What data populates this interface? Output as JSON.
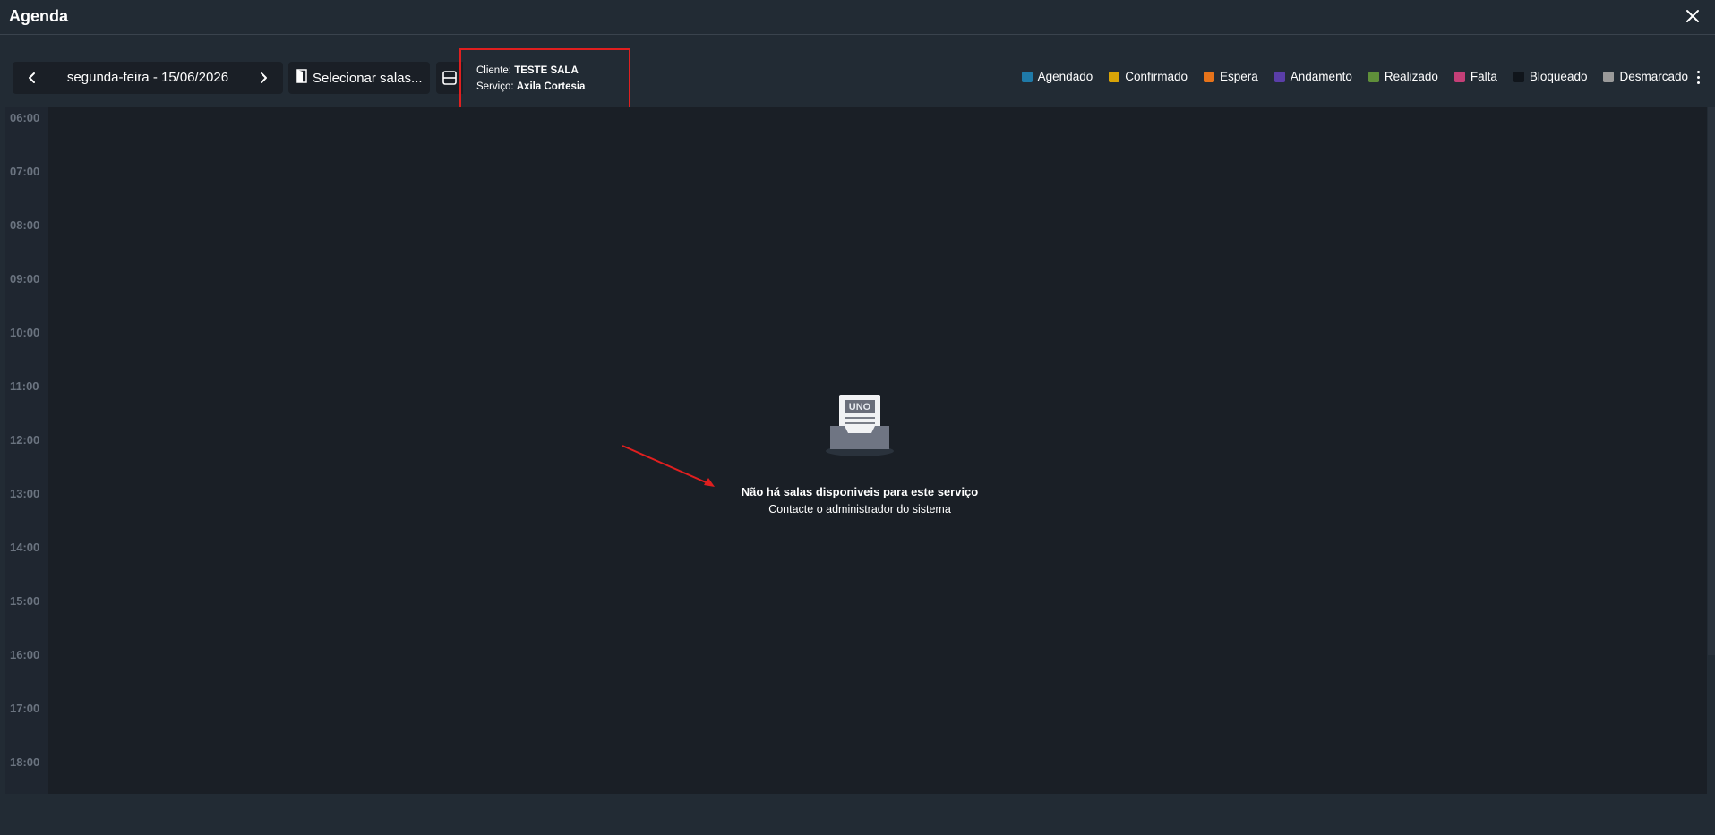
{
  "window": {
    "title": "Agenda"
  },
  "toolbar": {
    "date_label": "segunda-feira - 15/06/2026",
    "rooms_label": "Selecionar salas..."
  },
  "info": {
    "client_prefix": "Cliente: ",
    "client_value": "TESTE SALA",
    "service_prefix": "Serviço: ",
    "service_value": "Axila Cortesia"
  },
  "legend": [
    {
      "label": "Agendado",
      "color": "#1f7aa8"
    },
    {
      "label": "Confirmado",
      "color": "#d9a407"
    },
    {
      "label": "Espera",
      "color": "#e6731a"
    },
    {
      "label": "Andamento",
      "color": "#5a3ea8"
    },
    {
      "label": "Realizado",
      "color": "#5f8f3a"
    },
    {
      "label": "Falta",
      "color": "#c43f77"
    },
    {
      "label": "Bloqueado",
      "color": "#10151b"
    },
    {
      "label": "Desmarcado",
      "color": "#9a9a9a"
    }
  ],
  "times": [
    "06:00",
    "07:00",
    "08:00",
    "09:00",
    "10:00",
    "11:00",
    "12:00",
    "13:00",
    "14:00",
    "15:00",
    "16:00",
    "17:00",
    "18:00"
  ],
  "empty_state": {
    "icon_text": "UNO",
    "title": "Não há salas disponiveis para este serviço",
    "subtitle": "Contacte o administrador do sistema"
  },
  "colors": {
    "highlight": "#e01f1f"
  }
}
